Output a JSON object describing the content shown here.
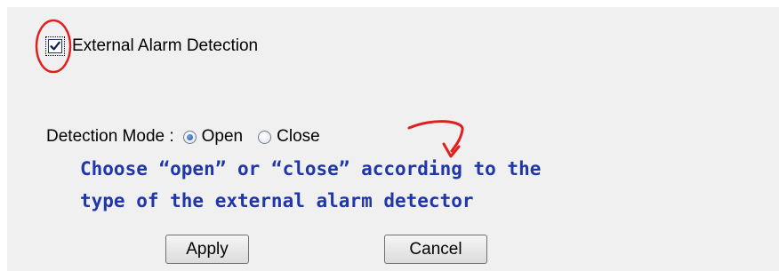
{
  "alarm": {
    "checked": true,
    "label": "External Alarm Detection"
  },
  "detection_mode": {
    "label": "Detection Mode :",
    "options": [
      {
        "label": "Open",
        "selected": true
      },
      {
        "label": "Close",
        "selected": false
      }
    ]
  },
  "annotation": {
    "line1": "Choose “open” or “close” according to the",
    "line2": "type of the external alarm detector",
    "color": "#1f37a8",
    "highlight_color": "#e02020"
  },
  "buttons": {
    "apply": "Apply",
    "cancel": "Cancel"
  }
}
